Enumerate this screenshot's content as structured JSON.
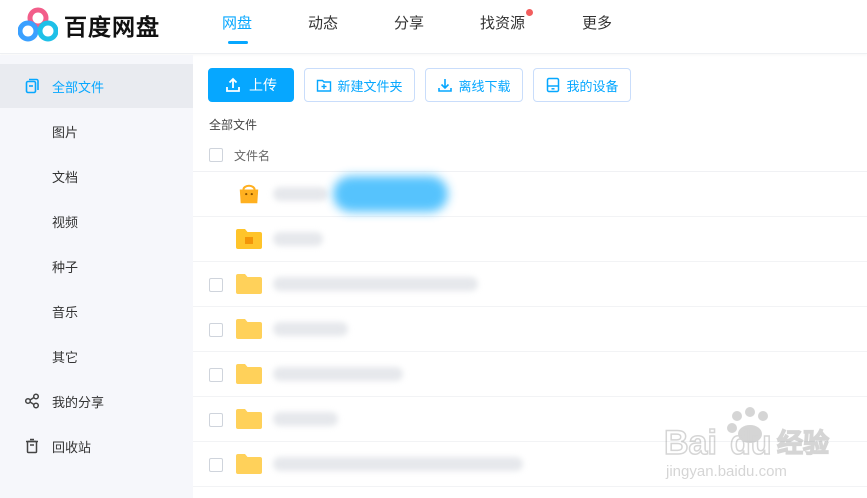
{
  "app": {
    "name": "百度网盘"
  },
  "nav": {
    "items": [
      {
        "label": "网盘",
        "active": true
      },
      {
        "label": "动态"
      },
      {
        "label": "分享"
      },
      {
        "label": "找资源",
        "has_dot": true
      },
      {
        "label": "更多"
      }
    ]
  },
  "sidebar": {
    "items": [
      {
        "label": "全部文件",
        "icon": "files-icon",
        "active": true
      },
      {
        "label": "图片"
      },
      {
        "label": "文档"
      },
      {
        "label": "视频"
      },
      {
        "label": "种子"
      },
      {
        "label": "音乐"
      },
      {
        "label": "其它"
      },
      {
        "label": "我的分享",
        "icon": "share-icon"
      },
      {
        "label": "回收站",
        "icon": "trash-icon"
      }
    ]
  },
  "toolbar": {
    "upload": "上传",
    "new_folder": "新建文件夹",
    "offline_download": "离线下载",
    "my_devices": "我的设备"
  },
  "breadcrumb": "全部文件",
  "file_list": {
    "column_name": "文件名",
    "rows": [
      {
        "icon": "special-folder-icon",
        "name_blurred": true,
        "has_checkbox": false
      },
      {
        "icon": "document-folder-icon",
        "name_blurred": true,
        "has_checkbox": false
      },
      {
        "icon": "folder-icon",
        "name_blurred": true,
        "has_checkbox": true
      },
      {
        "icon": "folder-icon",
        "name_blurred": true,
        "has_checkbox": true
      },
      {
        "icon": "folder-icon",
        "name_blurred": true,
        "has_checkbox": true
      },
      {
        "icon": "folder-icon",
        "name_blurred": true,
        "has_checkbox": true
      },
      {
        "icon": "folder-icon",
        "name_blurred": true,
        "has_checkbox": true
      }
    ]
  },
  "watermark": {
    "brand": "Baidu经验",
    "url": "jingyan.baidu.com"
  },
  "colors": {
    "accent": "#06a7ff",
    "folder": "#ffd15a",
    "notification_dot": "#f25e5e"
  }
}
